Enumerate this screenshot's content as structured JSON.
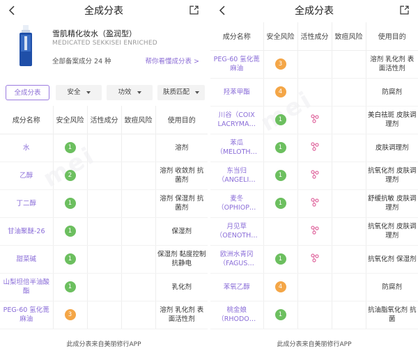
{
  "colors": {
    "accent": "#8d6fd6",
    "green": "#6cbf5f",
    "orange": "#f4a647"
  },
  "left": {
    "nav": {
      "title": "全成分表"
    },
    "product": {
      "name": "雪肌精化妆水（盈润型）",
      "name_en": "MEDICATED SEKKISEI ENRICHED",
      "count": "全部备案成分 24 种",
      "help_link": "帮你看懂成分表 >"
    },
    "filters": {
      "all": "全成分表",
      "safety": "安全",
      "effect": "功效",
      "skin": "肤质匹配"
    },
    "table": {
      "headers": [
        "成分名称",
        "安全风险",
        "活性成分",
        "致痘风险",
        "使用目的"
      ],
      "rows": [
        {
          "name": "水",
          "risk": "1",
          "risk_level": "green",
          "active": false,
          "acne": "",
          "purpose": "溶剂"
        },
        {
          "name": "乙醇",
          "risk": "2",
          "risk_level": "green",
          "active": false,
          "acne": "",
          "purpose": "溶剂 收敛剂 抗菌剂"
        },
        {
          "name": "丁二醇",
          "risk": "1",
          "risk_level": "green",
          "active": false,
          "acne": "",
          "purpose": "溶剂 保湿剂 抗菌剂"
        },
        {
          "name": "甘油聚醚-26",
          "risk": "1",
          "risk_level": "green",
          "active": false,
          "acne": "",
          "purpose": "保湿剂"
        },
        {
          "name": "甜菜碱",
          "risk": "1",
          "risk_level": "green",
          "active": false,
          "acne": "",
          "purpose": "保湿剂 黏度控制 抗静电"
        },
        {
          "name": "山梨坦倍半油酸酯",
          "risk": "1",
          "risk_level": "green",
          "active": false,
          "acne": "",
          "purpose": "乳化剂"
        },
        {
          "name": "PEG-60 氢化蓖麻油",
          "risk": "3",
          "risk_level": "orange",
          "active": false,
          "acne": "",
          "purpose": "溶剂 乳化剂 表面活性剂"
        }
      ]
    },
    "footer": "此成分表来自美丽修行APP"
  },
  "right": {
    "nav": {
      "title": "全成分表"
    },
    "table": {
      "headers": [
        "成分名称",
        "安全风险",
        "活性成分",
        "致痘风险",
        "使用目的"
      ],
      "rows": [
        {
          "name": "PEG-60 氢化蓖麻油",
          "risk": "3",
          "risk_level": "orange",
          "active": false,
          "acne": "",
          "purpose": "溶剂 乳化剂 表面活性剂"
        },
        {
          "name": "羟苯甲酯",
          "risk": "4",
          "risk_level": "orange",
          "active": false,
          "acne": "",
          "purpose": "防腐剂"
        },
        {
          "name": "川谷（COIX LACRYMA…",
          "risk": "1",
          "risk_level": "green",
          "active": true,
          "acne": "",
          "purpose": "美白祛斑 皮肤调理剂"
        },
        {
          "name": "苯瓜（MELOTH…",
          "risk": "1",
          "risk_level": "green",
          "active": true,
          "acne": "",
          "purpose": "皮肤调理剂"
        },
        {
          "name": "东当归（ANGELI…",
          "risk": "1",
          "risk_level": "green",
          "active": true,
          "acne": "",
          "purpose": "抗氧化剂 皮肤调理剂"
        },
        {
          "name": "麦冬（OPHIOP…",
          "risk": "1",
          "risk_level": "green",
          "active": true,
          "acne": "",
          "purpose": "舒缓抗敏 皮肤调理剂"
        },
        {
          "name": "月见草（OENOTH…",
          "risk": "",
          "risk_level": "none",
          "active": true,
          "acne": "",
          "purpose": "抗氧化剂 皮肤调理剂"
        },
        {
          "name": "欧洲水青冈（FAGUS…",
          "risk": "1",
          "risk_level": "green",
          "active": true,
          "acne": "",
          "purpose": "抗氧化剂 保湿剂"
        },
        {
          "name": "苯氧乙醇",
          "risk": "4",
          "risk_level": "orange",
          "active": false,
          "acne": "",
          "purpose": "防腐剂"
        },
        {
          "name": "桃金娘（RHODO…",
          "risk": "1",
          "risk_level": "green",
          "active": false,
          "acne": "",
          "purpose": "抗油脂氧化剂 抗菌"
        }
      ]
    },
    "footer": "此成分表来自美丽修行APP"
  }
}
